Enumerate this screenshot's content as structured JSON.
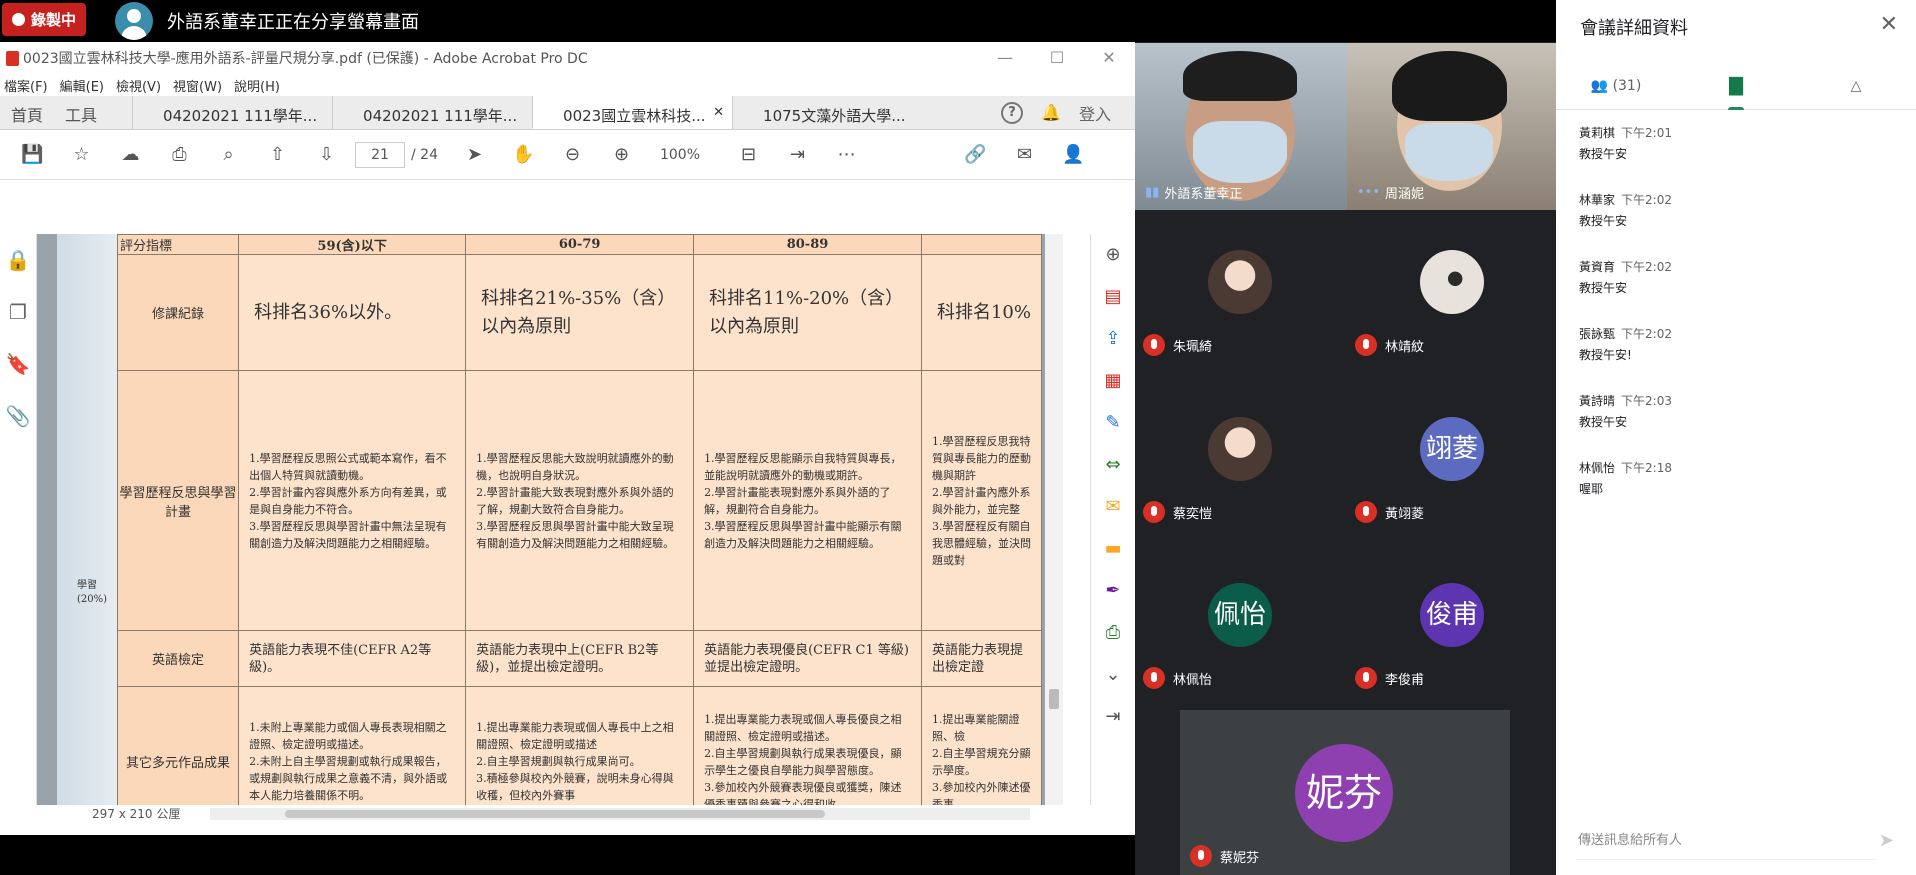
{
  "topbar": {
    "recording_label": "錄製中",
    "share_text": "外語系董幸正正在分享螢幕畫面"
  },
  "acrobat": {
    "title": "0023國立雲林科技大學-應用外語系-評量尺規分享.pdf (已保護) - Adobe Acrobat Pro DC",
    "menu": [
      "檔案(F)",
      "編輯(E)",
      "檢視(V)",
      "視窗(W)",
      "說明(H)"
    ],
    "nav": [
      "首頁",
      "工具"
    ],
    "tabs": [
      "04202021 111學年...",
      "04202021 111學年...",
      "0023國立雲林科技...",
      "1075文藻外語大學..."
    ],
    "sign_in": "登入",
    "page_current": "21",
    "page_total": "/ 24",
    "zoom": "100%",
    "status_size": "297 x 210 公厘",
    "rubric": {
      "header_label": "評分指標",
      "columns": [
        "59(含)以下",
        "60-79",
        "80-89"
      ],
      "rows": {
        "course": "修課紀錄",
        "portfolio": "學習歷程反思與學習計畫",
        "english": "英語檢定",
        "other": "其它多元作品成果",
        "side_label": "(20%)"
      },
      "course_cells": [
        "科排名36%以外。",
        "科排名21%-35%（含）以內為原則",
        "科排名11%-20%（含）以內為原則",
        "科排名10%"
      ],
      "portfolio_cells": [
        "1.學習歷程反思照公式或範本寫作，看不出個人特質與就讀動機。\n2.學習計畫內容與應外系方向有差異，或是與自身能力不符合。\n3.學習歷程反思與學習計畫中無法呈現有關創造力及解決問題能力之相關經驗。",
        "1.學習歷程反思能大致說明就讀應外的動機，也說明自身狀況。\n2.學習計畫能大致表現對應外系與外語的了解，規劃大致符合自身能力。\n3.學習歷程反思與學習計畫中能大致呈現有關創造力及解決問題能力之相關經驗。",
        "1.學習歷程反思能顯示自我特質與專長，並能說明就讀應外的動機或期許。\n2.學習計畫能表現對應外系與外語的了解，規劃符合自身能力。\n3.學習歷程反思與學習計畫中能顯示有關創造力及解決問題能力之相關經驗。",
        "1.學習歷程反思我特質與專長能力的歷動機與期許\n2.學習計畫內應外系與外能力，並完整\n3.學習歷程反有關自我思體經驗，並決問題或對"
      ],
      "english_cells": [
        "英語能力表現不佳(CEFR A2等級)。",
        "英語能力表現中上(CEFR B2等級)，並提出檢定證明。",
        "英語能力表現優良(CEFR C1 等級)並提出檢定證明。",
        "英語能力表現提出檢定證"
      ],
      "other_cells": [
        "1.未附上專業能力或個人專長表現相關之證照、檢定證明或描述。\n2.未附上自主學習規劃或執行成果報告，或規劃與執行成果之意義不清，與外語或本人能力培養關係不明。",
        "1.提出專業能力表現或個人專長中上之相關證照、檢定證明或描述\n2.自主學習規劃與執行成果尚可。\n3.積極參與校內外競賽，說明未身心得與收穫，但校內外賽事",
        "1.提出專業能力表現或個人專長優良之相關證照、檢定證明或描述。\n2.自主學習規劃與執行成果表現優良，顯示學生之優良自學能力與學習態度。\n3.參加校內外競賽表現優良或獲獎，陳述優秀事蹟與參賽之心得和收",
        "1.提出專業能關證照、檢\n2.自主學習規充分顯示學度。\n3.參加校內外陳述優秀事"
      ]
    }
  },
  "participants": {
    "video": [
      {
        "name": "外語系董幸正"
      },
      {
        "name": "周涵妮"
      }
    ],
    "grid": [
      {
        "name": "朱珮綺",
        "avatar_text": "",
        "color": "#d8c3b5"
      },
      {
        "name": "林靖紋",
        "avatar_text": "",
        "color": "#c7c0bb"
      },
      {
        "name": "蔡奕愷",
        "avatar_text": "",
        "color": "#d8bba8"
      },
      {
        "name": "黃翊菱",
        "avatar_text": "翊菱",
        "color": "#5c6bc0"
      },
      {
        "name": "林佩怡",
        "avatar_text": "佩怡",
        "color": "#0b5d4a"
      },
      {
        "name": "李俊甫",
        "avatar_text": "俊甫",
        "color": "#5e35b1"
      }
    ],
    "speaker": {
      "name": "蔡妮芬",
      "avatar_text": "妮芬",
      "color": "#8e3fb0"
    }
  },
  "panel": {
    "title": "會議詳細資料",
    "people_count": "(31)",
    "messages": [
      {
        "who": "黃莉棋",
        "time": "下午2:01",
        "text": "教授午安"
      },
      {
        "who": "林華家",
        "time": "下午2:02",
        "text": "教授午安"
      },
      {
        "who": "黃資育",
        "time": "下午2:02",
        "text": "教授午安"
      },
      {
        "who": "張詠甄",
        "time": "下午2:02",
        "text": "教授午安!"
      },
      {
        "who": "黃詩晴",
        "time": "下午2:03",
        "text": "教授午安"
      },
      {
        "who": "林佩怡",
        "time": "下午2:18",
        "text": "喔耶"
      }
    ],
    "input_placeholder": "傳送訊息給所有人"
  },
  "colors": {
    "recording": "#c5221f",
    "chat_accent": "#1a8a58",
    "muted_mic": "#d93025",
    "rubric_fill": "#fde3cc"
  }
}
